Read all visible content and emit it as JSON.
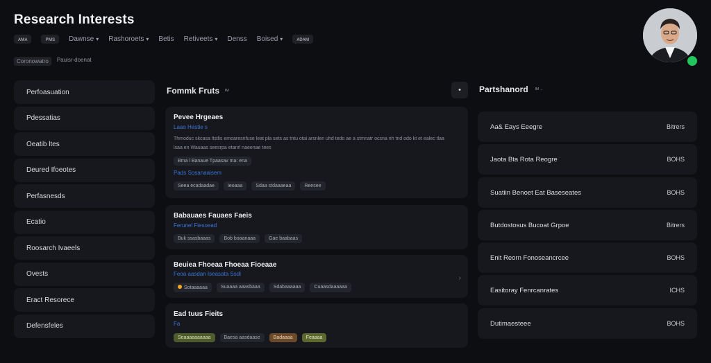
{
  "app": {
    "title": "Research Interests"
  },
  "nav": {
    "chips": [
      "ᴀᴍᴀ",
      "ᴘᴍs"
    ],
    "items": [
      {
        "label": "Dawnse",
        "caret": true
      },
      {
        "label": "Rashoroets",
        "caret": true
      },
      {
        "label": "Betis",
        "caret": false
      },
      {
        "label": "Retiveets",
        "caret": true
      },
      {
        "label": "Denss",
        "caret": false
      },
      {
        "label": "Boised",
        "caret": true
      }
    ],
    "end_chip": "ᴀᴅᴀᴍ"
  },
  "breadcrumb": {
    "chip": "Coronowatro",
    "label": "Pauisr-doenat"
  },
  "sidebar": {
    "items": [
      {
        "label": "Perfoasuation"
      },
      {
        "label": "Pdessatias"
      },
      {
        "label": "Oeatib ltes"
      },
      {
        "label": "Deured Ifoeotes"
      },
      {
        "label": "Perfasnesds"
      },
      {
        "label": "Ecatio"
      },
      {
        "label": "Roosarch Ivaeels"
      },
      {
        "label": "Ovests"
      },
      {
        "label": "Eract Resorece"
      },
      {
        "label": "Defensfeles"
      }
    ]
  },
  "center": {
    "header": "Fommk Fruts",
    "header_sub": "ᴵᴹ",
    "header_btn": "•",
    "cards": [
      {
        "title": "Pevee Hrgeaes",
        "link": "Laao Hestie s",
        "desc": "Thmoduc skcasa ltstlis emoaresnfuse leat pla sets as tntu otai arsnlen uhd tedo ae a stmnatr ocsna nh tnd odo kt et ealec tlaa lsaa en Wauaas seesrpa etanrl naeenae tees",
        "meta_tags": [
          "Bma l Banaue Tpaasav ma: ena"
        ],
        "link2": "Pads Sosanaaisem",
        "tags": [
          {
            "label": "Seea ecadaadae",
            "style": ""
          },
          {
            "label": "Ieoaaa",
            "style": ""
          },
          {
            "label": "Sdaa stdaaaeaa",
            "style": ""
          },
          {
            "label": "Reesee",
            "style": ""
          }
        ]
      },
      {
        "title": "Babauaes Fauaes Faeis",
        "link": "Ferunel Fiesoead",
        "tags": [
          {
            "label": "Buk ssasbaaas",
            "style": ""
          },
          {
            "label": "Bob boaanaaa",
            "style": ""
          },
          {
            "label": "Gae baabaas",
            "style": ""
          }
        ]
      },
      {
        "title": "Beuiea Fhoeaa Fhoeaa Fioeaae",
        "link": "Feoa aasdan  Iseasata Ssdl",
        "chevron": "›",
        "tags": [
          {
            "label": "Sotaaaaaa",
            "style": "dot"
          },
          {
            "label": "Suaaaa aaasbaaa",
            "style": ""
          },
          {
            "label": "Sdabaaaaaa",
            "style": ""
          },
          {
            "label": "Cuaasdaaaaaa",
            "style": ""
          }
        ]
      },
      {
        "title": "Ead tuus Fieits",
        "link": "Fa",
        "tags": [
          {
            "label": "Seaaaaaaaaaa",
            "style": "green"
          },
          {
            "label": "Baesa aasdaase",
            "style": ""
          },
          {
            "label": "Badaaaa",
            "style": "orange"
          },
          {
            "label": "Feaaaa",
            "style": "olive"
          }
        ]
      }
    ]
  },
  "right": {
    "header": "Partshanord",
    "header_sub": "ᴵᴹ ·",
    "rows": [
      {
        "label": "Aa& Eays Eeegre",
        "value": "Bitrers"
      },
      {
        "label": "Jaota Bta Rota Reogre",
        "value": "BOHS"
      },
      {
        "label": "Suatiin Benoet Eat Baseseates",
        "value": "BOHS"
      },
      {
        "label": "Butdostosus Bucoat Grpoe",
        "value": "Bitrers"
      },
      {
        "label": "Enit Reorn Fonoseancrcee",
        "value": "BOHS"
      },
      {
        "label": "Easitoray Fenrcanrates",
        "value": "ICHS"
      },
      {
        "label": "Dutimaesteee",
        "value": "BOHS"
      }
    ]
  },
  "user": {
    "status_color": "#22c55e"
  }
}
